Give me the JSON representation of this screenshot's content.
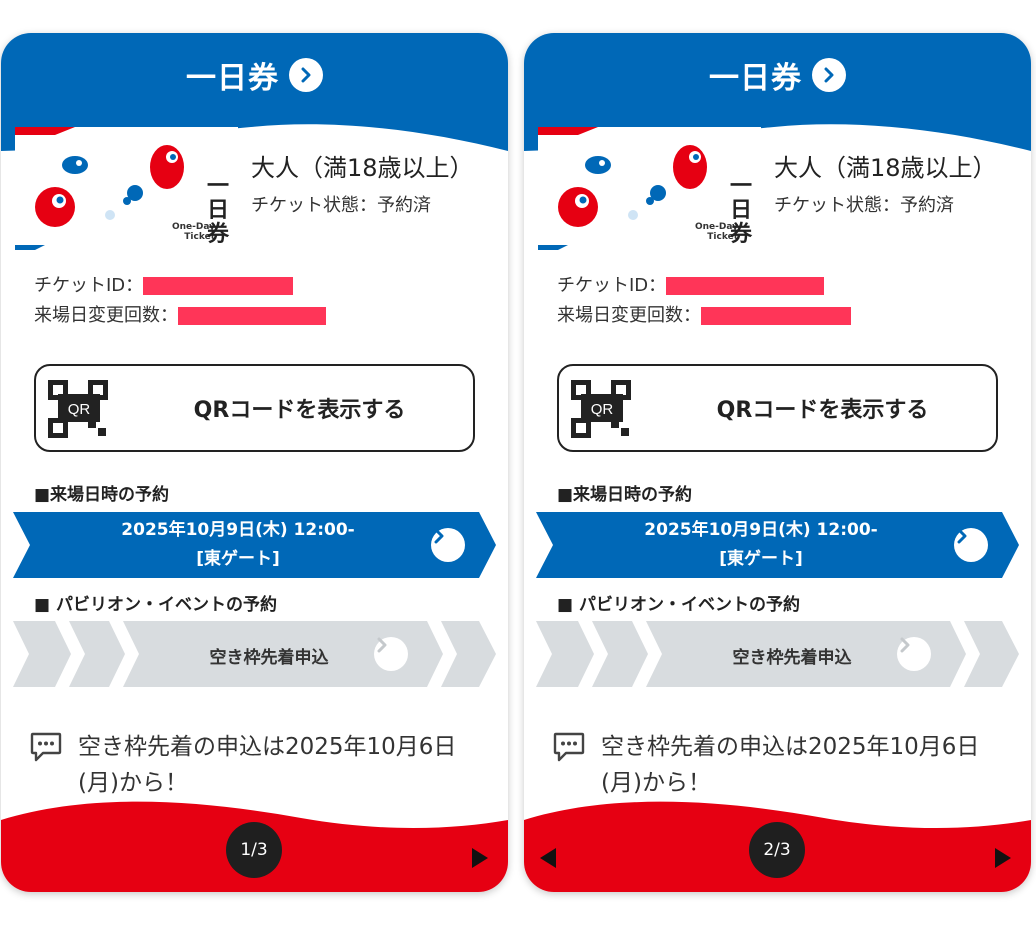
{
  "colors": {
    "brand_blue": "#0068b7",
    "brand_red": "#e60012",
    "gray_band": "#d8dcdf",
    "redaction": "#ff3558"
  },
  "cards": [
    {
      "header_title": "一日券",
      "ticket_image": {
        "en_line1": "One-Day",
        "en_line2": "Ticket",
        "jp_text": "一日券"
      },
      "ticket_type": "大人（満18歳以上）",
      "ticket_status": "チケット状態：予約済",
      "ticket_id_label": "チケットID：",
      "date_change_label": "来場日変更回数：",
      "qr_icon_text": "QR",
      "qr_button_label": "QRコードを表示する",
      "visit_section_title": "■来場日時の予約",
      "visit_datetime": "2025年10月9日(木) 12:00-",
      "visit_gate": "[東ゲート]",
      "pavilion_section_title": "■ パビリオン・イベントの予約",
      "pavilion_button_label": "空き枠先着申込",
      "notice_text": "空き枠先着の申込は2025年10月6日(月)から！",
      "page_indicator": "1/3"
    },
    {
      "header_title": "一日券",
      "ticket_image": {
        "en_line1": "One-Day",
        "en_line2": "Ticket",
        "jp_text": "一日券"
      },
      "ticket_type": "大人（満18歳以上）",
      "ticket_status": "チケット状態：予約済",
      "ticket_id_label": "チケットID：",
      "date_change_label": "来場日変更回数：",
      "qr_icon_text": "QR",
      "qr_button_label": "QRコードを表示する",
      "visit_section_title": "■来場日時の予約",
      "visit_datetime": "2025年10月9日(木) 12:00-",
      "visit_gate": "[東ゲート]",
      "pavilion_section_title": "■ パビリオン・イベントの予約",
      "pavilion_button_label": "空き枠先着申込",
      "notice_text": "空き枠先着の申込は2025年10月6日(月)から！",
      "page_indicator": "2/3"
    }
  ]
}
